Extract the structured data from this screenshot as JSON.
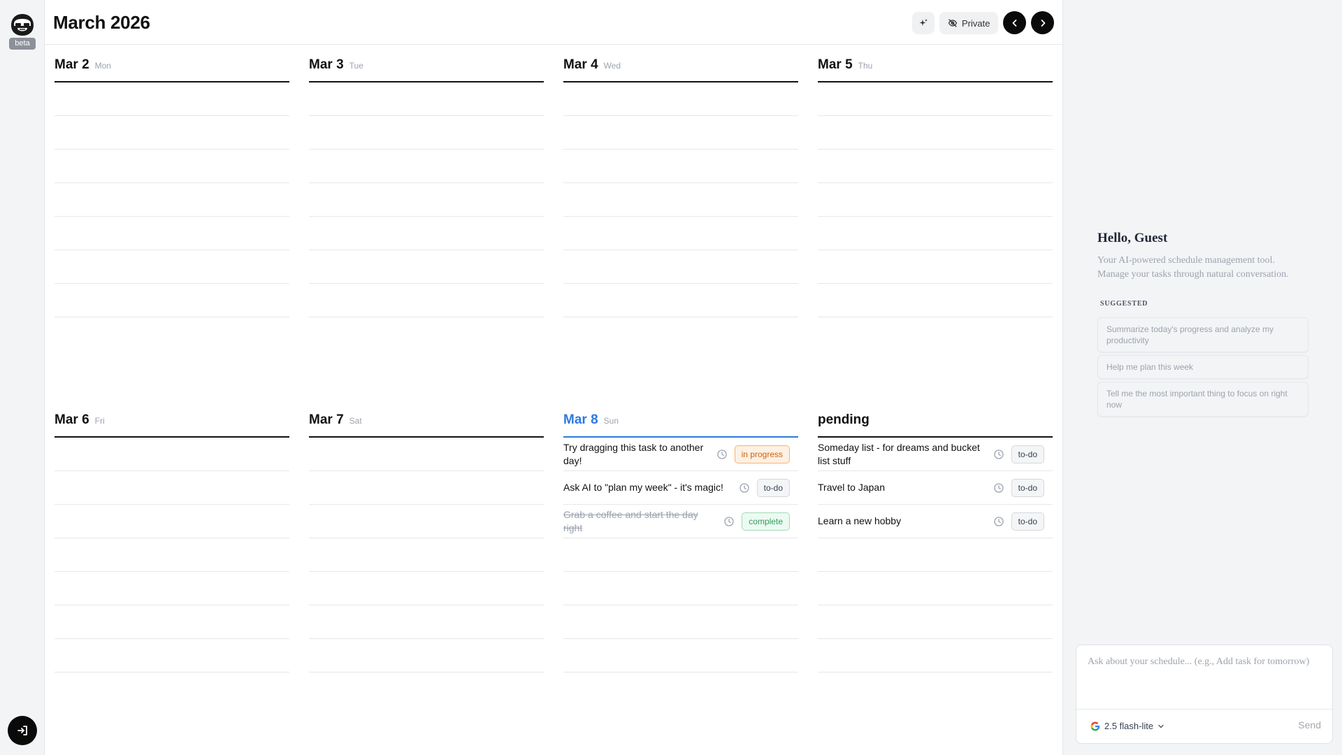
{
  "app": {
    "title": "March 2026",
    "beta_label": "beta"
  },
  "toolbar": {
    "private_label": "Private"
  },
  "days": [
    {
      "date": "Mar 2",
      "weekday": "Mon",
      "tasks": []
    },
    {
      "date": "Mar 3",
      "weekday": "Tue",
      "tasks": []
    },
    {
      "date": "Mar 4",
      "weekday": "Wed",
      "tasks": []
    },
    {
      "date": "Mar 5",
      "weekday": "Thu",
      "tasks": []
    },
    {
      "date": "Mar 6",
      "weekday": "Fri",
      "tasks": []
    },
    {
      "date": "Mar 7",
      "weekday": "Sat",
      "tasks": []
    },
    {
      "date": "Mar 8",
      "weekday": "Sun",
      "today": true,
      "tasks": [
        {
          "title": "Try dragging this task to another day!",
          "status": "in progress"
        },
        {
          "title": "Ask AI to \"plan my week\" - it's magic!",
          "status": "to-do"
        },
        {
          "title": "Grab a coffee and start the day right",
          "status": "complete"
        }
      ]
    },
    {
      "date": "pending",
      "weekday": "",
      "tasks": [
        {
          "title": "Someday list - for dreams and bucket list stuff",
          "status": "to-do"
        },
        {
          "title": "Travel to Japan",
          "status": "to-do"
        },
        {
          "title": "Learn a new hobby",
          "status": "to-do"
        }
      ]
    }
  ],
  "assistant": {
    "greeting": "Hello, Guest",
    "subtitle": "Your AI-powered schedule management tool. Manage your tasks through natural conversation.",
    "suggested_label": "SUGGESTED",
    "suggestions": [
      "Summarize today's progress and analyze my productivity",
      "Help me plan this week",
      "Tell me the most important thing to focus on right now"
    ],
    "input_placeholder": "Ask about your schedule... (e.g., Add task for tomorrow)",
    "model": "2.5 flash-lite",
    "send_label": "Send"
  },
  "colors": {
    "accent": "#2d7ae0",
    "in_progress": "#d4600f",
    "complete": "#2f9e5b"
  }
}
